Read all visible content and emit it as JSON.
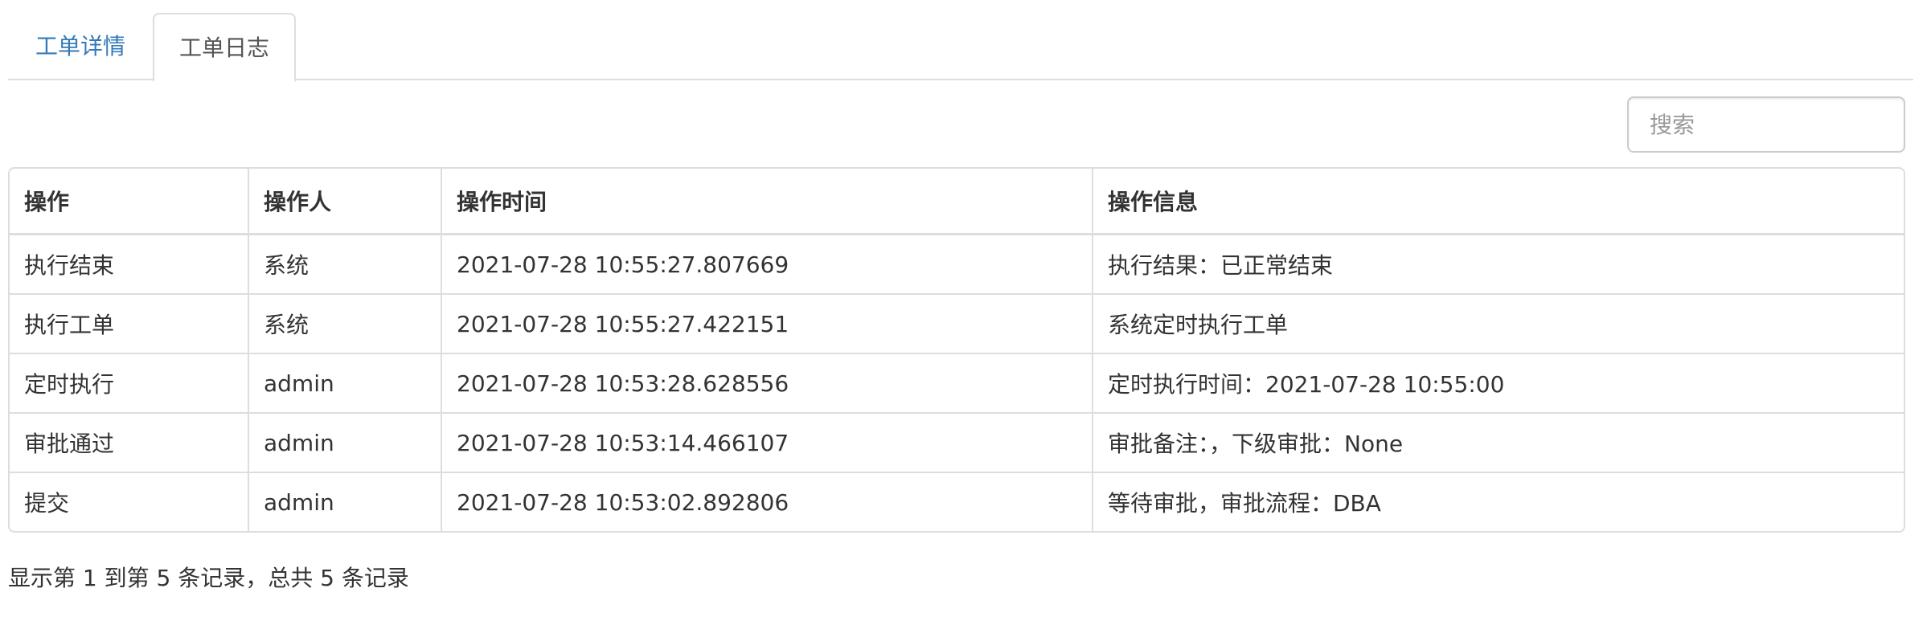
{
  "tabs": [
    {
      "label": "工单详情",
      "active": false
    },
    {
      "label": "工单日志",
      "active": true
    }
  ],
  "search": {
    "placeholder": "搜索",
    "value": ""
  },
  "table": {
    "columns": [
      "操作",
      "操作人",
      "操作时间",
      "操作信息"
    ],
    "rows": [
      [
        "执行结束",
        "系统",
        "2021-07-28 10:55:27.807669",
        "执行结果：已正常结束"
      ],
      [
        "执行工单",
        "系统",
        "2021-07-28 10:55:27.422151",
        "系统定时执行工单"
      ],
      [
        "定时执行",
        "admin",
        "2021-07-28 10:53:28.628556",
        "定时执行时间：2021-07-28 10:55:00"
      ],
      [
        "审批通过",
        "admin",
        "2021-07-28 10:53:14.466107",
        "审批备注：，下级审批：None"
      ],
      [
        "提交",
        "admin",
        "2021-07-28 10:53:02.892806",
        "等待审批，审批流程：DBA"
      ]
    ]
  },
  "pagination": {
    "info": "显示第 1 到第 5 条记录，总共 5 条记录"
  },
  "colors": {
    "link": "#337ab7",
    "border": "#dddddd",
    "text": "#333333"
  }
}
